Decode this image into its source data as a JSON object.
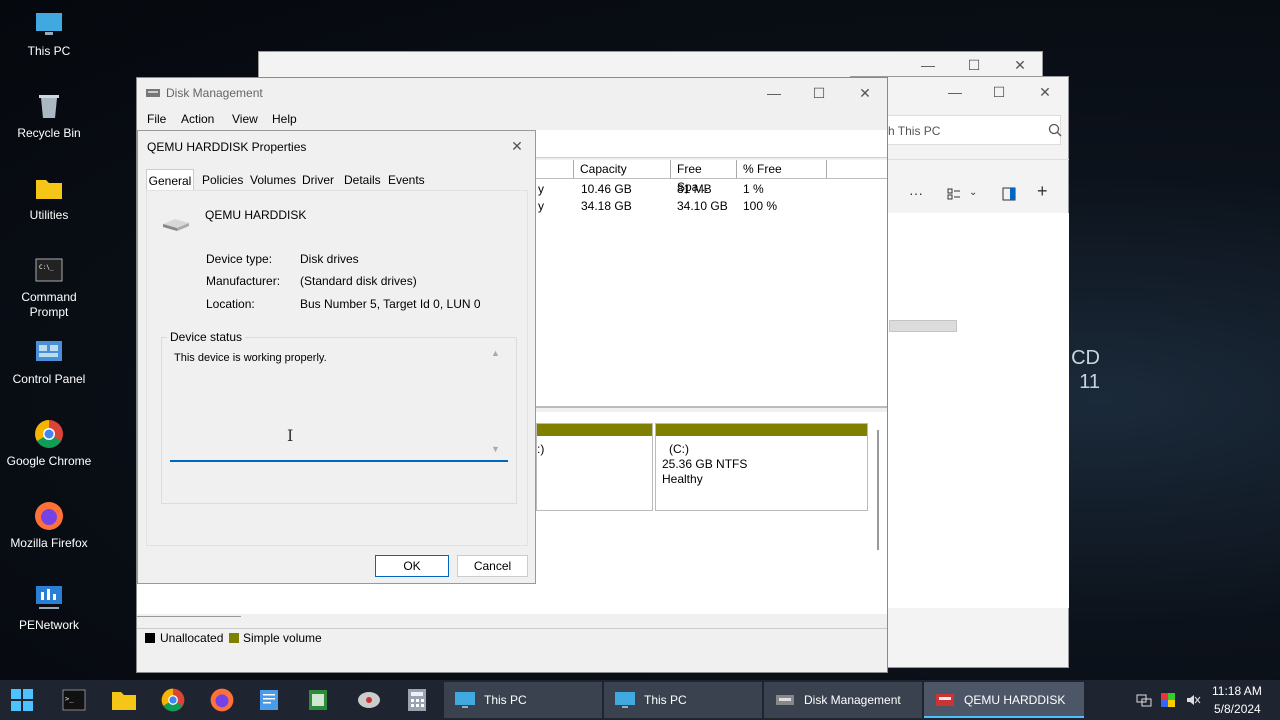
{
  "desktop": {
    "icons": [
      {
        "label": "This PC"
      },
      {
        "label": "Recycle Bin"
      },
      {
        "label": "Utilities"
      },
      {
        "label": "Command Prompt"
      },
      {
        "label": "Control Panel"
      },
      {
        "label": "Google Chrome"
      },
      {
        "label": "Mozilla Firefox"
      },
      {
        "label": "PENetwork"
      }
    ],
    "wallpaper_text": "CD 11"
  },
  "explorer_back": {
    "search_placeholder": "ch This PC"
  },
  "disk_mgmt": {
    "title": "Disk Management",
    "menu": [
      "File",
      "Action",
      "View",
      "Help"
    ],
    "columns": [
      "Capacity",
      "Free Spa...",
      "% Free"
    ],
    "rows": [
      {
        "type": "y",
        "capacity": "10.46 GB",
        "free": "81 MB",
        "pct": "1 %"
      },
      {
        "type": "y",
        "capacity": "34.18 GB",
        "free": "34.10 GB",
        "pct": "100 %"
      }
    ],
    "partition_left_label": ":)",
    "partition_c": {
      "name": "(C:)",
      "size": "25.36 GB NTFS",
      "status": "Healthy"
    },
    "legend": [
      {
        "label": "Unallocated",
        "color": "#000000"
      },
      {
        "label": "Simple volume",
        "color": "#808000"
      }
    ]
  },
  "properties": {
    "title": "QEMU HARDDISK Properties",
    "tabs": [
      "General",
      "Policies",
      "Volumes",
      "Driver",
      "Details",
      "Events"
    ],
    "device_name": "QEMU HARDDISK",
    "fields": [
      {
        "label": "Device type:",
        "value": "Disk drives"
      },
      {
        "label": "Manufacturer:",
        "value": "(Standard disk drives)"
      },
      {
        "label": "Location:",
        "value": "Bus Number 5, Target Id 0, LUN 0"
      }
    ],
    "status_group": "Device status",
    "status_text": "This device is working properly.",
    "ok": "OK",
    "cancel": "Cancel"
  },
  "taskbar": {
    "tasks": [
      {
        "label": "This PC"
      },
      {
        "label": "This PC"
      },
      {
        "label": "Disk Management"
      },
      {
        "label": "QEMU HARDDISK P..."
      }
    ],
    "time": "11:18 AM",
    "date": "5/8/2024",
    "accent": "#0078d4"
  }
}
